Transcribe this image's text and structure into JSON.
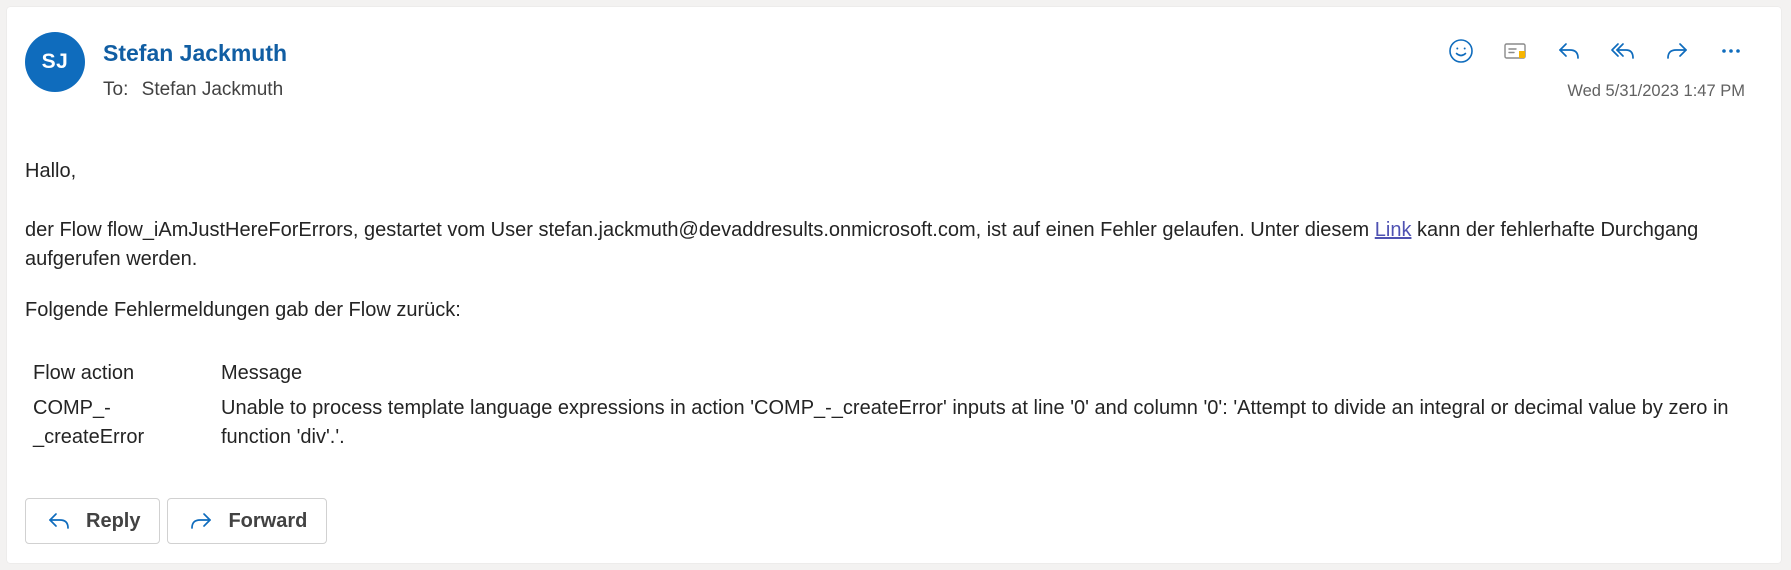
{
  "message": {
    "sender": {
      "initials": "SJ",
      "name": "Stefan Jackmuth",
      "avatar_color": "#0f6cbd"
    },
    "to_label": "To:",
    "to_name": "Stefan Jackmuth",
    "timestamp": "Wed 5/31/2023 1:47 PM"
  },
  "toolbar": {
    "icons": [
      "emoji-icon",
      "immersive-reader-icon",
      "reply-icon",
      "reply-all-icon",
      "forward-icon",
      "more-icon"
    ]
  },
  "body": {
    "greeting": "Hallo,",
    "para_before_link": "der Flow flow_iAmJustHereForErrors, gestartet vom User stefan.jackmuth@devaddresults.onmicrosoft.com, ist auf einen Fehler gelaufen. Unter diesem ",
    "link_text": "Link",
    "para_after_link": " kann der fehlerhafte Durchgang aufgerufen werden.",
    "errors_intro": "Folgende Fehlermeldungen gab der Flow zurück:"
  },
  "error_table": {
    "headers": [
      "Flow action",
      "Message"
    ],
    "rows": [
      {
        "action": "COMP_-_createError",
        "message": "Unable to process template language expressions in action 'COMP_-_createError' inputs at line '0' and column '0': 'Attempt to divide an integral or decimal value by zero in function 'div'.'."
      }
    ]
  },
  "actions": {
    "reply_label": "Reply",
    "forward_label": "Forward"
  },
  "colors": {
    "accent": "#115ea3",
    "link": "#4f52b2"
  }
}
